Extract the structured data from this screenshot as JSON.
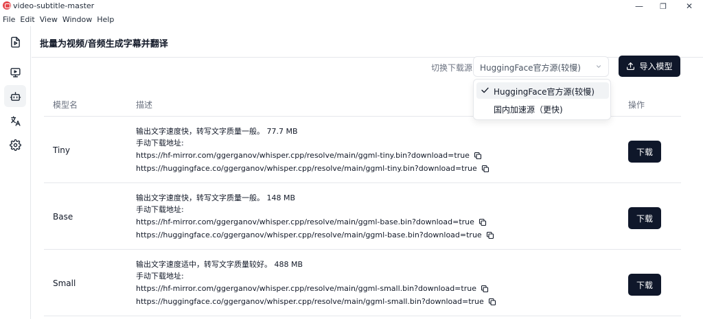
{
  "window": {
    "title": "video-subtitle-master",
    "minimize": "—",
    "restore": "❐",
    "close": "✕"
  },
  "menu": [
    "File",
    "Edit",
    "View",
    "Window",
    "Help"
  ],
  "page": {
    "title": "批量为视频/音频生成字幕并翻译"
  },
  "toolbar": {
    "source_label": "切换下载源:",
    "source_value": "HuggingFace官方源(较慢)",
    "import_label": "导入模型"
  },
  "dropdown": {
    "options": [
      "HuggingFace官方源(较慢)",
      "国内加速源（更快)"
    ],
    "selected_index": 0
  },
  "table": {
    "headers": {
      "name": "模型名",
      "desc": "描述",
      "action": "操作"
    },
    "manual_label": "手动下载地址:",
    "download_label": "下载",
    "rows": [
      {
        "name": "Tiny",
        "summary": "输出文字速度快，转写文字质量一般。 77.7 MB",
        "mirror_url": "https://hf-mirror.com/ggerganov/whisper.cpp/resolve/main/ggml-tiny.bin?download=true",
        "hf_url": "https://huggingface.co/ggerganov/whisper.cpp/resolve/main/ggml-tiny.bin?download=true"
      },
      {
        "name": "Base",
        "summary": "输出文字速度快，转写文字质量一般。 148 MB",
        "mirror_url": "https://hf-mirror.com/ggerganov/whisper.cpp/resolve/main/ggml-base.bin?download=true",
        "hf_url": "https://huggingface.co/ggerganov/whisper.cpp/resolve/main/ggml-base.bin?download=true"
      },
      {
        "name": "Small",
        "summary": "输出文字速度适中，转写文字质量较好。 488 MB",
        "mirror_url": "https://hf-mirror.com/ggerganov/whisper.cpp/resolve/main/ggml-small.bin?download=true",
        "hf_url": "https://huggingface.co/ggerganov/whisper.cpp/resolve/main/ggml-small.bin?download=true"
      }
    ]
  },
  "colors": {
    "primary": "#0f172a",
    "border": "#e5e7eb",
    "muted": "#6b7280",
    "app_icon": "#e5484d"
  }
}
